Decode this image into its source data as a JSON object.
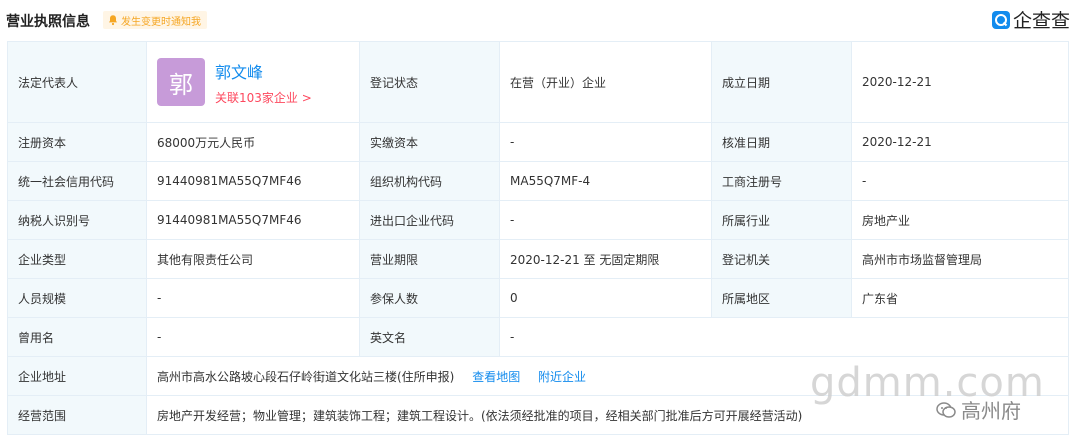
{
  "header": {
    "title": "营业执照信息",
    "notify_label": "发生变更时通知我",
    "brand_text": "企查查"
  },
  "rows": {
    "r1": {
      "c1": "法定代表人",
      "c2": "登记状态",
      "v2": "在营（开业）企业",
      "c3": "成立日期",
      "v3": "2020-12-21"
    },
    "r2": {
      "c1": "注册资本",
      "v1": "68000万元人民币",
      "c2": "实缴资本",
      "v2": "-",
      "c3": "核准日期",
      "v3": "2020-12-21"
    },
    "r3": {
      "c1": "统一社会信用代码",
      "v1": "91440981MA55Q7MF46",
      "c2": "组织机构代码",
      "v2": "MA55Q7MF-4",
      "c3": "工商注册号",
      "v3": "-"
    },
    "r4": {
      "c1": "纳税人识别号",
      "v1": "91440981MA55Q7MF46",
      "c2": "进出口企业代码",
      "v2": "-",
      "c3": "所属行业",
      "v3": "房地产业"
    },
    "r5": {
      "c1": "企业类型",
      "v1": "其他有限责任公司",
      "c2": "营业期限",
      "v2": "2020-12-21 至 无固定期限",
      "c3": "登记机关",
      "v3": "高州市市场监督管理局"
    },
    "r6": {
      "c1": "人员规模",
      "v1": "-",
      "c2": "参保人数",
      "v2": "0",
      "c3": "所属地区",
      "v3": "广东省"
    },
    "r7": {
      "c1": "曾用名",
      "v1": "-",
      "c2": "英文名",
      "v2": "-"
    },
    "r8": {
      "c1": "企业地址",
      "v1": "高州市高水公路坡心段石仔岭街道文化站三楼(住所申报)",
      "map_link": "查看地图",
      "nearby_link": "附近企业"
    },
    "r9": {
      "c1": "经营范围",
      "v1": "房地产开发经营；物业管理；建筑装饰工程；建筑工程设计。(依法须经批准的项目，经相关部门批准后方可开展经营活动)"
    }
  },
  "legal_rep": {
    "avatar_char": "郭",
    "name": "郭文峰",
    "related": "关联103家企业 >"
  },
  "watermark": {
    "text": "gdmm.com",
    "sub": "高州府"
  },
  "colors": {
    "accent": "#128bed",
    "label_bg": "#f2f9fc",
    "border": "#e4eef6",
    "avatar": "#c79bd9",
    "related": "#fd485e",
    "notify": "#f5a623"
  }
}
